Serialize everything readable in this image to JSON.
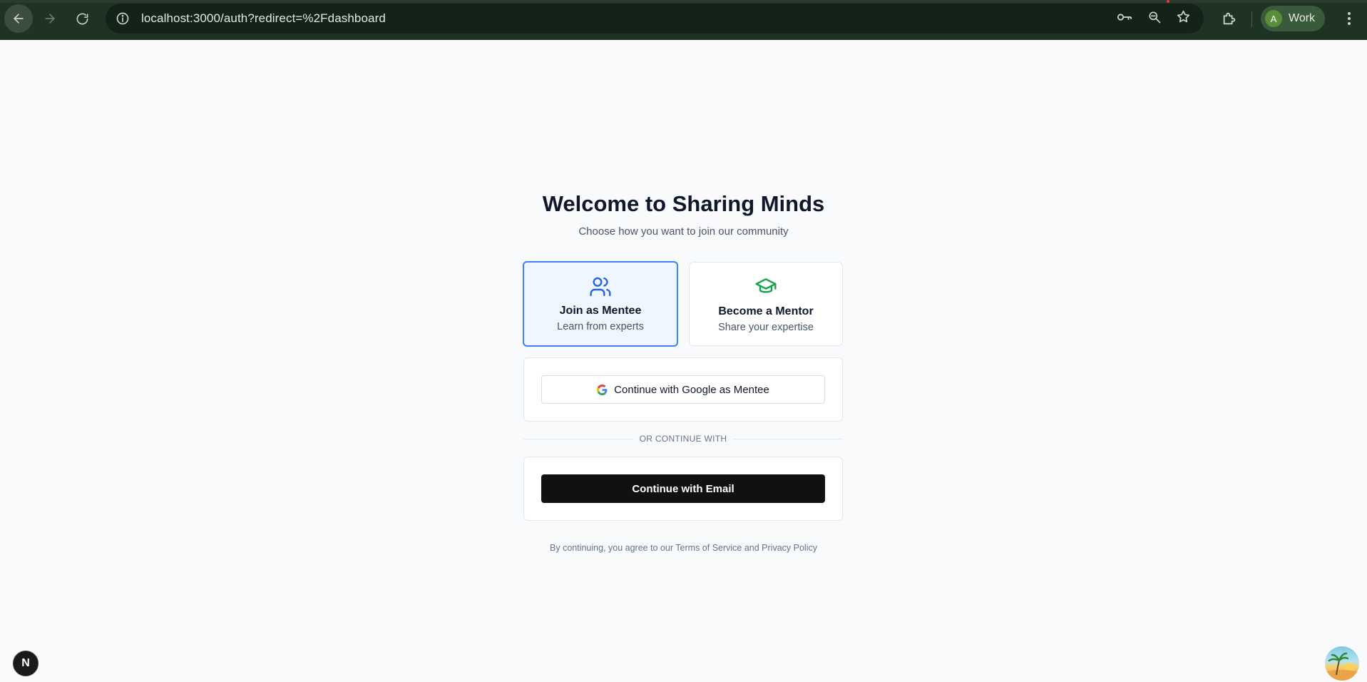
{
  "browser": {
    "url": "localhost:3000/auth?redirect=%2Fdashboard",
    "profile_initial": "A",
    "profile_name": "Work"
  },
  "page": {
    "title": "Welcome to Sharing Minds",
    "subtitle": "Choose how you want to join our community",
    "roles": [
      {
        "title": "Join as Mentee",
        "description": "Learn from experts",
        "icon": "users-icon",
        "selected": true,
        "accent": "#2563eb"
      },
      {
        "title": "Become a Mentor",
        "description": "Share your expertise",
        "icon": "graduation-cap-icon",
        "selected": false,
        "accent": "#16a34a"
      }
    ],
    "google_button_label": "Continue with Google as Mentee",
    "divider_text": "OR CONTINUE WITH",
    "email_button_label": "Continue with Email",
    "legal_text": "By continuing, you agree to our Terms of Service and Privacy Policy"
  },
  "overlay": {
    "dev_badge": "N"
  }
}
